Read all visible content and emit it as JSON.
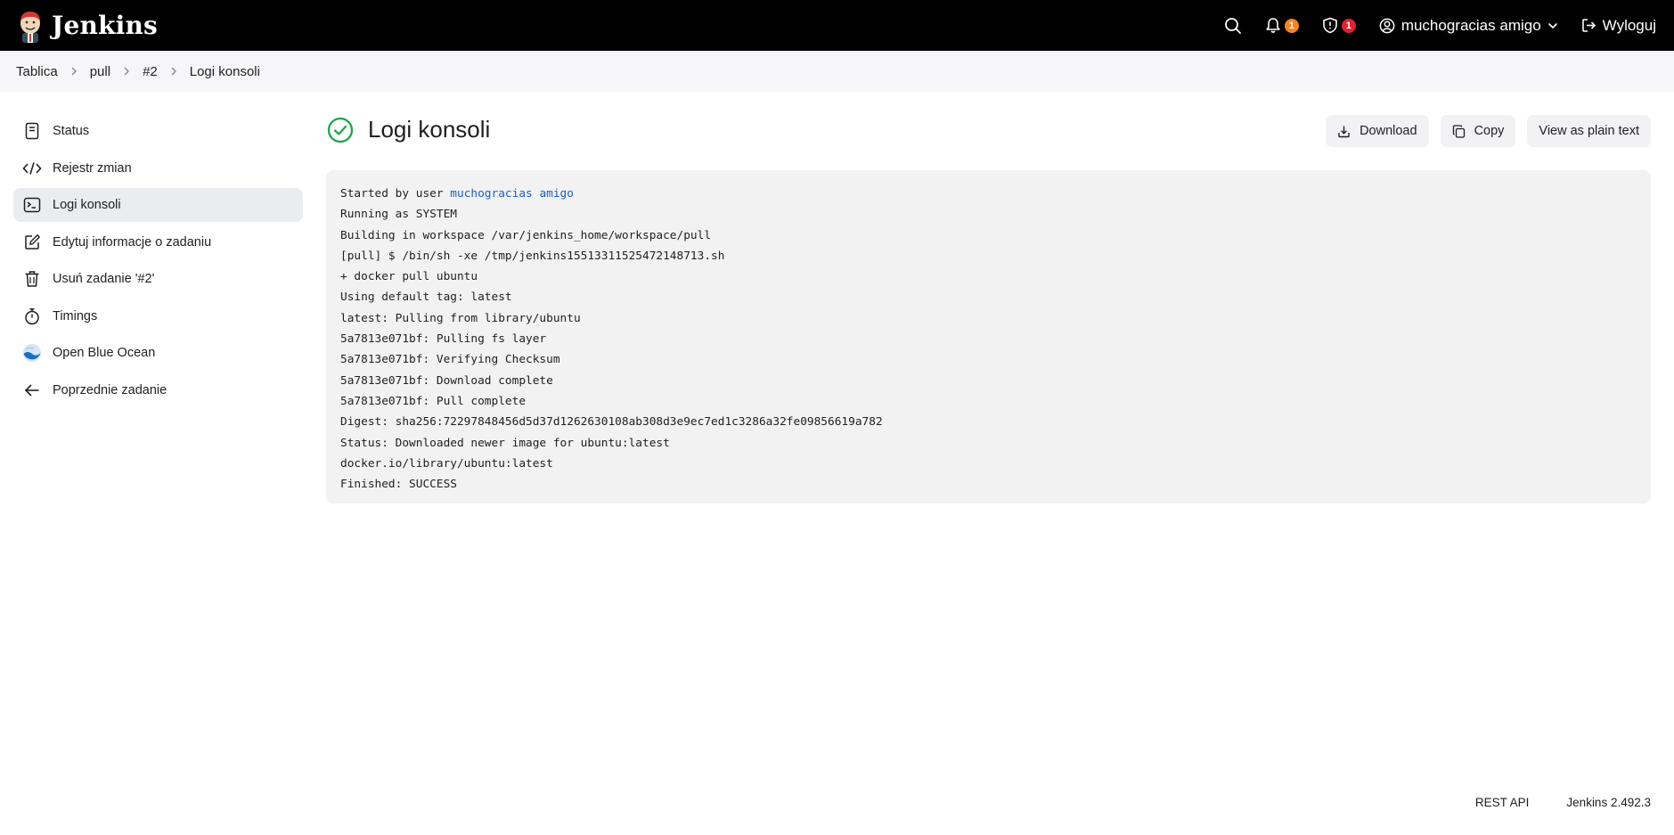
{
  "header": {
    "brand": "Jenkins",
    "notifications_count": "1",
    "security_count": "1",
    "user_name": "muchogracias amigo",
    "logout_label": "Wyloguj",
    "colors": {
      "background": "#000000",
      "notification_badge": "#f5841f",
      "security_badge": "#e3202f"
    }
  },
  "breadcrumb": {
    "items": [
      "Tablica",
      "pull",
      "#2",
      "Logi konsoli"
    ]
  },
  "sidebar": {
    "items": [
      {
        "label": "Status",
        "icon": "document-icon"
      },
      {
        "label": "Rejestr zmian",
        "icon": "code-icon"
      },
      {
        "label": "Logi konsoli",
        "icon": "terminal-icon",
        "active": true
      },
      {
        "label": "Edytuj informacje o zadaniu",
        "icon": "edit-icon"
      },
      {
        "label": "Usuń zadanie '#2'",
        "icon": "trash-icon"
      },
      {
        "label": "Timings",
        "icon": "stopwatch-icon"
      },
      {
        "label": "Open Blue Ocean",
        "icon": "blue-ocean-icon"
      },
      {
        "label": "Poprzednie zadanie",
        "icon": "arrow-left-icon"
      }
    ]
  },
  "main": {
    "title": "Logi konsoli",
    "status_color": "#1ea64b",
    "actions": {
      "download": "Download",
      "copy": "Copy",
      "plain_text": "View as plain text"
    },
    "console": {
      "first_prefix": "Started by user ",
      "first_link": "muchogracias amigo",
      "lines": [
        "Running as SYSTEM",
        "Building in workspace /var/jenkins_home/workspace/pull",
        "[pull] $ /bin/sh -xe /tmp/jenkins15513311525472148713.sh",
        "+ docker pull ubuntu",
        "Using default tag: latest",
        "latest: Pulling from library/ubuntu",
        "5a7813e071bf: Pulling fs layer",
        "5a7813e071bf: Verifying Checksum",
        "5a7813e071bf: Download complete",
        "5a7813e071bf: Pull complete",
        "Digest: sha256:72297848456d5d37d1262630108ab308d3e9ec7ed1c3286a32fe09856619a782",
        "Status: Downloaded newer image for ubuntu:latest",
        "docker.io/library/ubuntu:latest",
        "Finished: SUCCESS"
      ]
    }
  },
  "footer": {
    "rest_api": "REST API",
    "version": "Jenkins 2.492.3"
  }
}
